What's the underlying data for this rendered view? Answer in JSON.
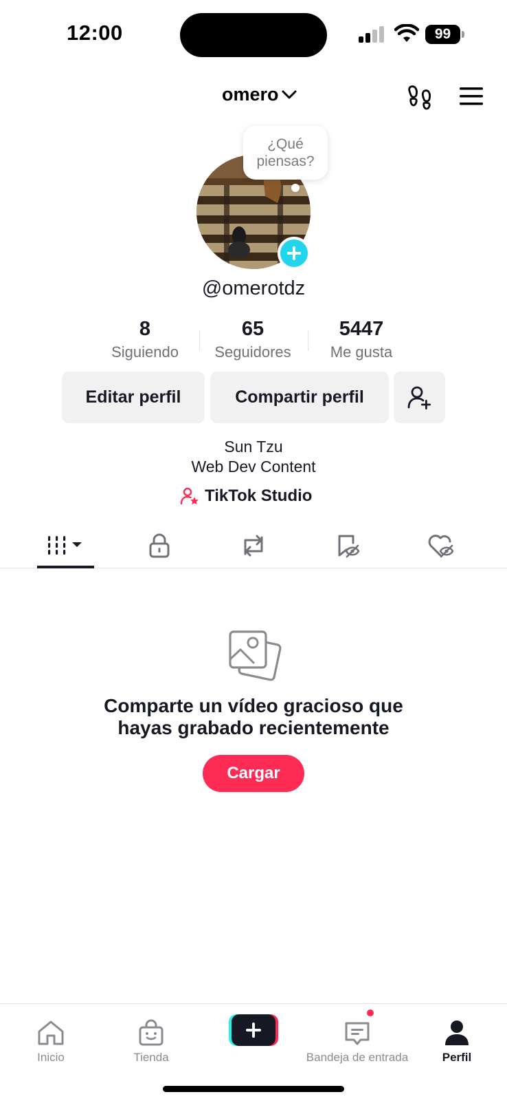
{
  "status_bar": {
    "time": "12:00",
    "battery": "99"
  },
  "header": {
    "title": "omero"
  },
  "avatar": {
    "thought_bubble": "¿Qué piensas?"
  },
  "profile": {
    "handle": "@omerotdz"
  },
  "stats": [
    {
      "value": "8",
      "label": "Siguiendo"
    },
    {
      "value": "65",
      "label": "Seguidores"
    },
    {
      "value": "5447",
      "label": "Me gusta"
    }
  ],
  "buttons": {
    "edit": "Editar perfil",
    "share": "Compartir perfil"
  },
  "bio": {
    "line1": "Sun Tzu",
    "line2": "Web Dev Content"
  },
  "studio": {
    "label": "TikTok Studio"
  },
  "empty_state": {
    "line1": "Comparte un vídeo gracioso que",
    "line2": "hayas grabado recientemente",
    "button": "Cargar"
  },
  "bottom_nav": [
    {
      "label": "Inicio",
      "icon": "home-icon"
    },
    {
      "label": "Tienda",
      "icon": "shop-bag-icon"
    },
    {
      "label": "",
      "icon": "create-plus-icon"
    },
    {
      "label": "Bandeja de entrada",
      "icon": "inbox-icon"
    },
    {
      "label": "Perfil",
      "icon": "profile-icon"
    }
  ],
  "colors": {
    "accent": "#fe2c55",
    "cyan": "#20d5ec",
    "text": "#161823",
    "muted": "#8a8b91"
  }
}
